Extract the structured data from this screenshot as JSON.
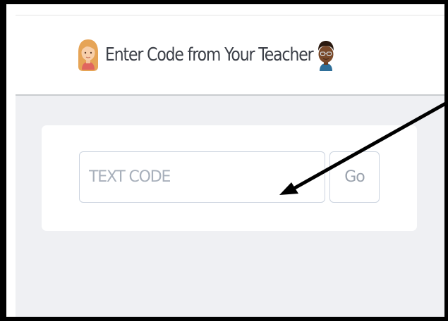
{
  "header": {
    "title": "Enter Code from Your Teacher",
    "left_avatar": "girl-avatar-icon",
    "right_avatar": "boy-avatar-icon"
  },
  "code_form": {
    "placeholder": "TEXT CODE",
    "value": "",
    "go_label": "Go"
  },
  "annotation": {
    "type": "arrow",
    "color": "#000000",
    "points_to": "code-input"
  },
  "colors": {
    "title_text": "#3b3f47",
    "page_background": "#eff0f3",
    "card_background": "#ffffff",
    "input_border": "#cbd3df",
    "placeholder_text": "#a8b0bb",
    "frame_border": "#000000"
  }
}
